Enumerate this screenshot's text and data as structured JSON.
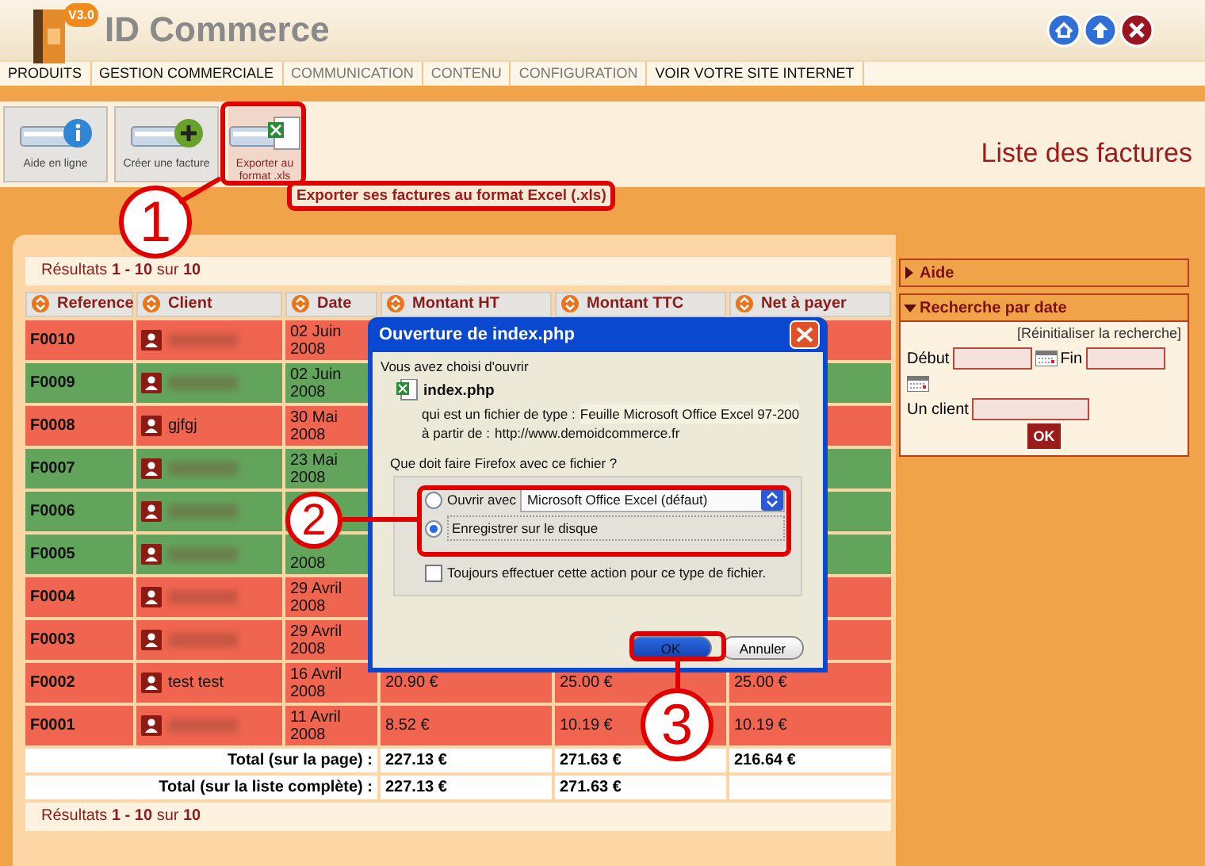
{
  "header": {
    "version_badge": "V3.0",
    "title": "ID Commerce",
    "icons": [
      {
        "kind": "home"
      },
      {
        "kind": "up"
      },
      {
        "kind": "close"
      }
    ]
  },
  "nav": [
    {
      "label": "PRODUITS",
      "disabled": false
    },
    {
      "label": "GESTION COMMERCIALE",
      "disabled": false
    },
    {
      "label": "COMMUNICATION",
      "disabled": true
    },
    {
      "label": "CONTENU",
      "disabled": true
    },
    {
      "label": "CONFIGURATION",
      "disabled": true
    },
    {
      "label": "VOIR VOTRE SITE INTERNET",
      "disabled": false
    }
  ],
  "toolbar": [
    {
      "label": "Aide en ligne",
      "kind": "info",
      "selected": false
    },
    {
      "label": "Créer une facture",
      "kind": "add",
      "selected": false
    },
    {
      "label": "Exporter au format .xls",
      "kind": "excel",
      "selected": true
    }
  ],
  "page_title": "Liste des factures",
  "tooltip": "Exporter ses factures au format Excel (.xls)",
  "results_top": "Résultats **1 - 10** sur **10**",
  "table": {
    "columns": [
      "Reference",
      "Client",
      "Date",
      "Montant HT",
      "Montant TTC",
      "Net à payer"
    ],
    "rows": [
      {
        "reference": "F0010",
        "client": {
          "kind": "redacted"
        },
        "date": "02 Juin 2008",
        "color": "#f0654f"
      },
      {
        "reference": "F0009",
        "client": {
          "kind": "redacted"
        },
        "date": "02 Juin 2008",
        "color": "#63a45c"
      },
      {
        "reference": "F0008",
        "client": {
          "kind": "text",
          "name": "gjfgj"
        },
        "date": "30 Mai 2008",
        "color": "#f0654f"
      },
      {
        "reference": "F0007",
        "client": {
          "kind": "redacted"
        },
        "date": "23 Mai 2008",
        "color": "#63a45c"
      },
      {
        "reference": "F0006",
        "client": {
          "kind": "redacted"
        },
        "color": "#63a45c"
      },
      {
        "reference": "F0005",
        "client": {
          "kind": "redacted"
        },
        "date": "2008",
        "color": "#63a45c"
      },
      {
        "reference": "F0004",
        "client": {
          "kind": "redacted"
        },
        "date": "29 Avril 2008",
        "color": "#f0654f"
      },
      {
        "reference": "F0003",
        "client": {
          "kind": "redacted"
        },
        "date": "29 Avril 2008",
        "color": "#f0654f"
      },
      {
        "reference": "F0002",
        "client": {
          "kind": "text",
          "name": "test test"
        },
        "date": "16 Avril 2008",
        "ht": "20.90 €",
        "ttc": "25.00 €",
        "net": "25.00 €",
        "color": "#f0654f"
      },
      {
        "reference": "F0001",
        "client": {
          "kind": "redacted"
        },
        "date": "11 Avril 2008",
        "ht": "8.52 €",
        "ttc": "10.19 €",
        "net": "10.19 €",
        "color": "#f0654f"
      }
    ],
    "totals": [
      {
        "label": "Total (sur la page) :",
        "ht": "227.13 €",
        "ttc": "271.63 €",
        "net": "216.64 €"
      },
      {
        "label": "Total (sur la liste complète) :",
        "ht": "227.13 €",
        "ttc": "271.63 €"
      }
    ]
  },
  "results_bottom": "Résultats **1 - 10** sur **10**",
  "sidebar": [
    {
      "title": "Aide",
      "expanded": false
    },
    {
      "title": "Recherche par date",
      "expanded": true,
      "reset_link": "[Réinitialiser la recherche]",
      "start_label": "Début",
      "end_label": "Fin",
      "client_label": "Un client",
      "button": "OK"
    }
  ],
  "dialog": {
    "title": "Ouverture de index.php",
    "intro": "Vous avez choisi d'ouvrir",
    "filename": "index.php",
    "type_label": "qui est un fichier de type :",
    "type_value": "Feuille Microsoft Office Excel 97-200",
    "from_label": "à partir de :",
    "from_value": "http://www.demoidcommerce.fr",
    "question": "Que doit faire Firefox avec ce fichier ?",
    "options": [
      {
        "label": "Ouvrir avec",
        "selected": false,
        "app": "Microsoft Office Excel (défaut)"
      },
      {
        "label": "Enregistrer sur le disque",
        "selected": true
      }
    ],
    "always": {
      "label": "Toujours effectuer cette action pour ce type de fichier.",
      "checked": false
    },
    "buttons": [
      {
        "label": "OK",
        "default": true
      },
      {
        "label": "Annuler",
        "default": false
      }
    ]
  },
  "annotations": [
    {
      "number": "1"
    },
    {
      "number": "2"
    },
    {
      "number": "3"
    }
  ]
}
